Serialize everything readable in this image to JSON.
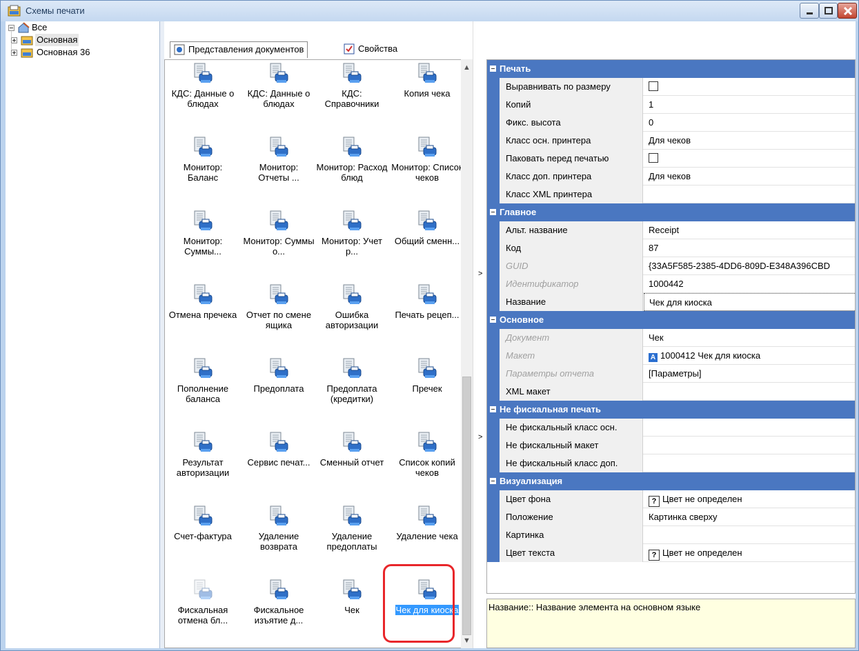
{
  "window": {
    "title": "Схемы печати"
  },
  "tree": {
    "root": "Все",
    "children": [
      "Основная",
      "Основная 36"
    ]
  },
  "tabs": [
    {
      "label": "Представления документов",
      "active": true
    },
    {
      "label": "Свойства",
      "active": false
    }
  ],
  "gallery": {
    "items": [
      "КДС: Данные о блюдах",
      "КДС: Данные о блюдах",
      "КДС: Справочники",
      "Копия чека",
      "Монитор: Баланс",
      "Монитор: Отчеты ...",
      "Монитор: Расход блюд",
      "Монитор: Список чеков",
      "Монитор: Суммы...",
      "Монитор: Суммы о...",
      "Монитор: Учет р...",
      "Общий сменн...",
      "Отмена пречека",
      "Отчет по смене ящика",
      "Ошибка авторизации",
      "Печать рецеп...",
      "Пополнение баланса",
      "Предоплата",
      "Предоплата (кредитки)",
      "Пречек",
      "Результат авторизации",
      "Сервис печат...",
      "Сменный отчет",
      "Список копий чеков",
      "Счет-фактура",
      "Удаление возврата",
      "Удаление предоплаты",
      "Удаление чека",
      "Фискальная отмена бл...",
      "Фискальное изъятие д...",
      "Чек",
      "Чек для киоска"
    ],
    "selected_index": 31,
    "disabled_index": 28
  },
  "properties": {
    "categories": [
      {
        "name": "Печать",
        "rows": [
          {
            "name": "Выравнивать по размеру",
            "value": "",
            "type": "checkbox",
            "checked": false
          },
          {
            "name": "Копий",
            "value": "1"
          },
          {
            "name": "Фикс. высота",
            "value": "0"
          },
          {
            "name": "Класс осн. принтера",
            "value": "Для чеков"
          },
          {
            "name": "Паковать перед печатью",
            "value": "",
            "type": "checkbox",
            "checked": false
          },
          {
            "name": "Класс доп. принтера",
            "value": "Для чеков"
          },
          {
            "name": "Класс XML принтера",
            "value": ""
          }
        ]
      },
      {
        "name": "Главное",
        "rows": [
          {
            "name": "Альт. название",
            "value": "Receipt"
          },
          {
            "name": "Код",
            "value": "87"
          },
          {
            "name": "GUID",
            "value": "{33A5F585-2385-4DD6-809D-E348A396CBD",
            "readonly": true
          },
          {
            "name": "Идентификатор",
            "value": "1000442",
            "readonly": true
          },
          {
            "name": "Название",
            "value": "Чек для киоска",
            "editing": true
          }
        ]
      },
      {
        "name": "Основное",
        "rows": [
          {
            "name": "Документ",
            "value": "Чек",
            "readonly": true
          },
          {
            "name": "Макет",
            "value": "1000412 Чек для киоска",
            "readonly": true,
            "badge": "A"
          },
          {
            "name": "Параметры отчета",
            "value": "[Параметры]",
            "readonly": true
          },
          {
            "name": "XML макет",
            "value": ""
          }
        ]
      },
      {
        "name": "Не фискальная печать",
        "rows": [
          {
            "name": "Не фискальный класс осн.",
            "value": ""
          },
          {
            "name": "Не фискальный макет",
            "value": ""
          },
          {
            "name": "Не фискальный класс доп.",
            "value": ""
          }
        ]
      },
      {
        "name": "Визуализация",
        "rows": [
          {
            "name": "Цвет фона",
            "value": "Цвет не определен",
            "qmark": "?"
          },
          {
            "name": "Положение",
            "value": "Картинка сверху"
          },
          {
            "name": "Картинка",
            "value": ""
          },
          {
            "name": "Цвет текста",
            "value": "Цвет не определен",
            "qmark": "?"
          }
        ]
      }
    ]
  },
  "description": "Название:: Название элемента на основном языке",
  "colors": {
    "category_bg": "#4a77c1",
    "selection": "#3399ff",
    "highlight_ring": "#e8262a",
    "description_bg": "#ffffe1"
  }
}
